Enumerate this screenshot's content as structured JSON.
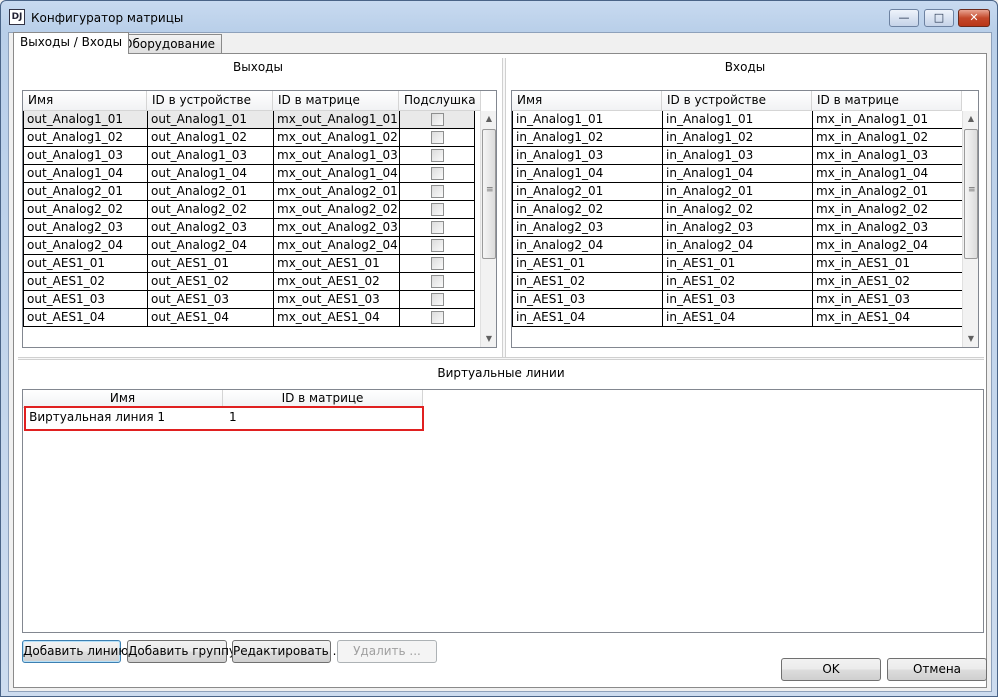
{
  "window": {
    "title": "Конфигуратор матрицы",
    "icon_label": "DJ",
    "controls": {
      "minimize": "—",
      "maximize": "□",
      "close": "✕"
    }
  },
  "tabs": [
    {
      "label": "Выходы / Входы",
      "active": true
    },
    {
      "label": "Оборудование",
      "active": false
    }
  ],
  "outputs": {
    "caption": "Выходы",
    "columns": [
      "Имя",
      "ID в устройстве",
      "ID в матрице",
      "Подслушка"
    ],
    "rows": [
      {
        "name": "out_Analog1_01",
        "device_id": "out_Analog1_01",
        "matrix_id": "mx_out_Analog1_01",
        "listen": false
      },
      {
        "name": "out_Analog1_02",
        "device_id": "out_Analog1_02",
        "matrix_id": "mx_out_Analog1_02",
        "listen": false
      },
      {
        "name": "out_Analog1_03",
        "device_id": "out_Analog1_03",
        "matrix_id": "mx_out_Analog1_03",
        "listen": false
      },
      {
        "name": "out_Analog1_04",
        "device_id": "out_Analog1_04",
        "matrix_id": "mx_out_Analog1_04",
        "listen": false
      },
      {
        "name": "out_Analog2_01",
        "device_id": "out_Analog2_01",
        "matrix_id": "mx_out_Analog2_01",
        "listen": false
      },
      {
        "name": "out_Analog2_02",
        "device_id": "out_Analog2_02",
        "matrix_id": "mx_out_Analog2_02",
        "listen": false
      },
      {
        "name": "out_Analog2_03",
        "device_id": "out_Analog2_03",
        "matrix_id": "mx_out_Analog2_03",
        "listen": false
      },
      {
        "name": "out_Analog2_04",
        "device_id": "out_Analog2_04",
        "matrix_id": "mx_out_Analog2_04",
        "listen": false
      },
      {
        "name": "out_AES1_01",
        "device_id": "out_AES1_01",
        "matrix_id": "mx_out_AES1_01",
        "listen": false
      },
      {
        "name": "out_AES1_02",
        "device_id": "out_AES1_02",
        "matrix_id": "mx_out_AES1_02",
        "listen": false
      },
      {
        "name": "out_AES1_03",
        "device_id": "out_AES1_03",
        "matrix_id": "mx_out_AES1_03",
        "listen": false
      },
      {
        "name": "out_AES1_04",
        "device_id": "out_AES1_04",
        "matrix_id": "mx_out_AES1_04",
        "listen": false
      }
    ]
  },
  "inputs": {
    "caption": "Входы",
    "columns": [
      "Имя",
      "ID в устройстве",
      "ID в матрице"
    ],
    "rows": [
      {
        "name": "in_Analog1_01",
        "device_id": "in_Analog1_01",
        "matrix_id": "mx_in_Analog1_01"
      },
      {
        "name": "in_Analog1_02",
        "device_id": "in_Analog1_02",
        "matrix_id": "mx_in_Analog1_02"
      },
      {
        "name": "in_Analog1_03",
        "device_id": "in_Analog1_03",
        "matrix_id": "mx_in_Analog1_03"
      },
      {
        "name": "in_Analog1_04",
        "device_id": "in_Analog1_04",
        "matrix_id": "mx_in_Analog1_04"
      },
      {
        "name": "in_Analog2_01",
        "device_id": "in_Analog2_01",
        "matrix_id": "mx_in_Analog2_01"
      },
      {
        "name": "in_Analog2_02",
        "device_id": "in_Analog2_02",
        "matrix_id": "mx_in_Analog2_02"
      },
      {
        "name": "in_Analog2_03",
        "device_id": "in_Analog2_03",
        "matrix_id": "mx_in_Analog2_03"
      },
      {
        "name": "in_Analog2_04",
        "device_id": "in_Analog2_04",
        "matrix_id": "mx_in_Analog2_04"
      },
      {
        "name": "in_AES1_01",
        "device_id": "in_AES1_01",
        "matrix_id": "mx_in_AES1_01"
      },
      {
        "name": "in_AES1_02",
        "device_id": "in_AES1_02",
        "matrix_id": "mx_in_AES1_02"
      },
      {
        "name": "in_AES1_03",
        "device_id": "in_AES1_03",
        "matrix_id": "mx_in_AES1_03"
      },
      {
        "name": "in_AES1_04",
        "device_id": "in_AES1_04",
        "matrix_id": "mx_in_AES1_04"
      }
    ]
  },
  "virtual_lines": {
    "caption": "Виртуальные линии",
    "columns": [
      "Имя",
      "ID в матрице"
    ],
    "rows": [
      {
        "name": "Виртуальная линия 1",
        "matrix_id": "1"
      }
    ]
  },
  "buttons": {
    "add_line": "Добавить линию",
    "add_group": "Добавить группу",
    "edit": "Редактировать ...",
    "delete": "Удалить ...",
    "ok": "OK",
    "cancel": "Отмена"
  },
  "colors": {
    "highlight": "#e02020",
    "selection": "#e9e9e9"
  }
}
